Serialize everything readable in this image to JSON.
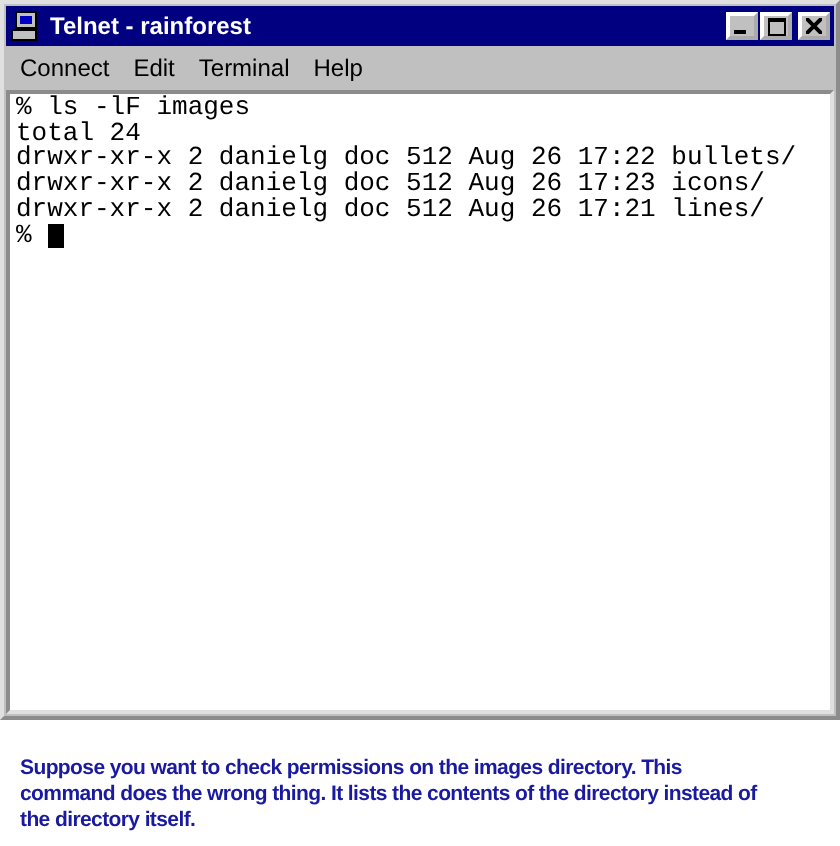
{
  "window": {
    "title": "Telnet - rainforest"
  },
  "menu": [
    "Connect",
    "Edit",
    "Terminal",
    "Help"
  ],
  "terminal": {
    "lines": [
      "% ls -lF images",
      "total 24",
      "drwxr-xr-x 2 danielg doc 512 Aug 26 17:22 bullets/",
      "drwxr-xr-x 2 danielg doc 512 Aug 26 17:23 icons/",
      "drwxr-xr-x 2 danielg doc 512 Aug 26 17:21 lines/"
    ],
    "prompt": "%"
  },
  "caption": "Suppose you want to check permissions on the images directory. This command does the wrong thing. It lists the contents of the directory instead of the directory itself."
}
